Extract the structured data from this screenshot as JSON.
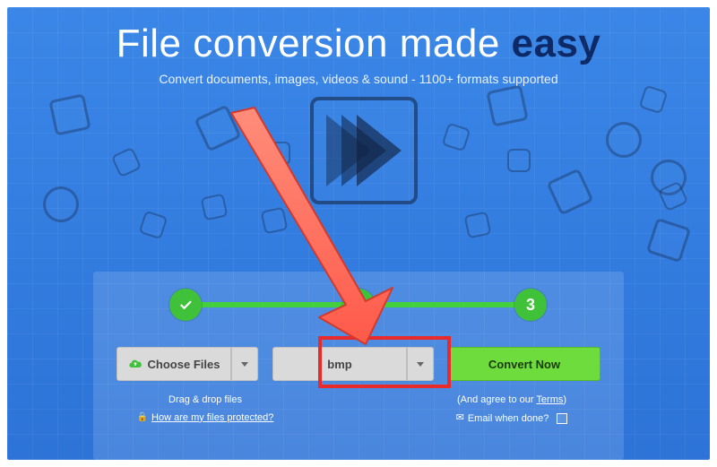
{
  "header": {
    "title_plain": "File conversion made ",
    "title_emph": "easy",
    "subtitle": "Convert documents, images, videos & sound - 1100+ formats supported"
  },
  "steps": {
    "step1_done": true,
    "step2_done": true,
    "step3_label": "3"
  },
  "actions": {
    "choose_label": "Choose Files",
    "format_selected": "bmp",
    "convert_label": "Convert Now"
  },
  "hints": {
    "drag_text": "Drag & drop files",
    "protection_text": "How are my files protected?",
    "agree_prefix": "(And agree to our ",
    "agree_link": "Terms",
    "agree_suffix": ")",
    "email_text": "Email when done?"
  },
  "colors": {
    "accent_green": "#3fc239",
    "accent_red": "#e92a2a",
    "blue_bg": "#2d73d8"
  }
}
